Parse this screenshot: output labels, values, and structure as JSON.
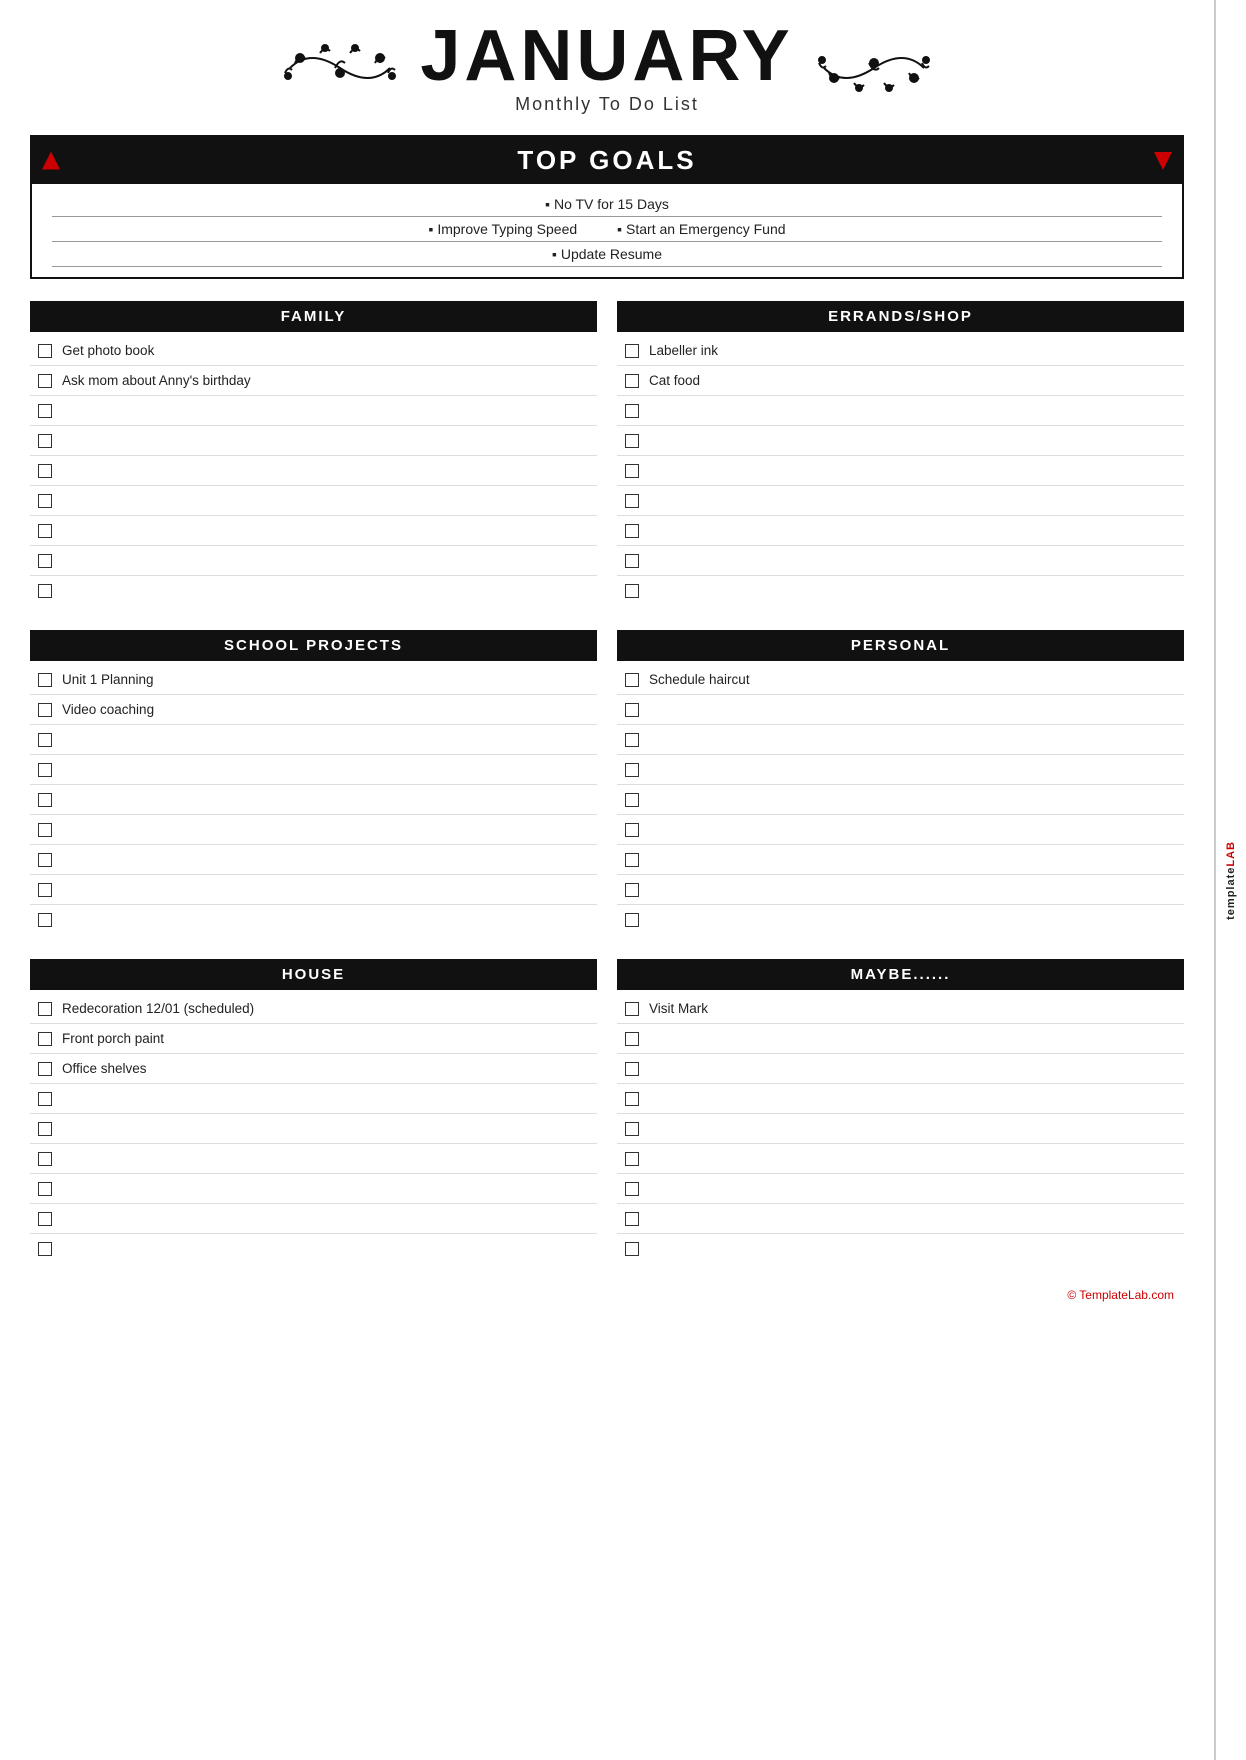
{
  "header": {
    "month": "JANUARY",
    "subtitle": "Monthly To Do List"
  },
  "side_tab": {
    "line1": "templatelab",
    "brand": "LAB",
    "prefix": "template"
  },
  "top_goals": {
    "section_title": "TOP GOALS",
    "rows": [
      [
        {
          "text": "No TV for 15 Days"
        }
      ],
      [
        {
          "text": "Improve Typing Speed"
        },
        {
          "text": "Start an Emergency Fund"
        }
      ],
      [
        {
          "text": "Update Resume"
        }
      ]
    ]
  },
  "sections": [
    {
      "id": "family",
      "title": "FAMILY",
      "items": [
        {
          "checked": false,
          "label": "Get photo book"
        },
        {
          "checked": false,
          "label": "Ask mom about Anny's birthday"
        },
        {
          "checked": false,
          "label": ""
        },
        {
          "checked": false,
          "label": ""
        },
        {
          "checked": false,
          "label": ""
        },
        {
          "checked": false,
          "label": ""
        },
        {
          "checked": false,
          "label": ""
        },
        {
          "checked": false,
          "label": ""
        },
        {
          "checked": false,
          "label": ""
        }
      ]
    },
    {
      "id": "errands",
      "title": "ERRANDS/SHOP",
      "items": [
        {
          "checked": false,
          "label": "Labeller ink"
        },
        {
          "checked": false,
          "label": "Cat food"
        },
        {
          "checked": false,
          "label": ""
        },
        {
          "checked": false,
          "label": ""
        },
        {
          "checked": false,
          "label": ""
        },
        {
          "checked": false,
          "label": ""
        },
        {
          "checked": false,
          "label": ""
        },
        {
          "checked": false,
          "label": ""
        },
        {
          "checked": false,
          "label": ""
        }
      ]
    },
    {
      "id": "school",
      "title": "SCHOOL PROJECTS",
      "items": [
        {
          "checked": false,
          "label": "Unit 1 Planning"
        },
        {
          "checked": false,
          "label": "Video coaching"
        },
        {
          "checked": false,
          "label": ""
        },
        {
          "checked": false,
          "label": ""
        },
        {
          "checked": false,
          "label": ""
        },
        {
          "checked": false,
          "label": ""
        },
        {
          "checked": false,
          "label": ""
        },
        {
          "checked": false,
          "label": ""
        },
        {
          "checked": false,
          "label": ""
        }
      ]
    },
    {
      "id": "personal",
      "title": "PERSONAL",
      "items": [
        {
          "checked": false,
          "label": "Schedule haircut"
        },
        {
          "checked": false,
          "label": ""
        },
        {
          "checked": false,
          "label": ""
        },
        {
          "checked": false,
          "label": ""
        },
        {
          "checked": false,
          "label": ""
        },
        {
          "checked": false,
          "label": ""
        },
        {
          "checked": false,
          "label": ""
        },
        {
          "checked": false,
          "label": ""
        },
        {
          "checked": false,
          "label": ""
        }
      ]
    },
    {
      "id": "house",
      "title": "HOUSE",
      "items": [
        {
          "checked": false,
          "label": "Redecoration 12/01 (scheduled)"
        },
        {
          "checked": false,
          "label": "Front porch paint"
        },
        {
          "checked": false,
          "label": "Office shelves"
        },
        {
          "checked": false,
          "label": ""
        },
        {
          "checked": false,
          "label": ""
        },
        {
          "checked": false,
          "label": ""
        },
        {
          "checked": false,
          "label": ""
        },
        {
          "checked": false,
          "label": ""
        },
        {
          "checked": false,
          "label": ""
        }
      ]
    },
    {
      "id": "maybe",
      "title": "MAYBE......",
      "items": [
        {
          "checked": false,
          "label": "Visit Mark"
        },
        {
          "checked": false,
          "label": ""
        },
        {
          "checked": false,
          "label": ""
        },
        {
          "checked": false,
          "label": ""
        },
        {
          "checked": false,
          "label": ""
        },
        {
          "checked": false,
          "label": ""
        },
        {
          "checked": false,
          "label": ""
        },
        {
          "checked": false,
          "label": ""
        },
        {
          "checked": false,
          "label": ""
        }
      ]
    }
  ],
  "footer": {
    "text": "© TemplateLab.com"
  }
}
